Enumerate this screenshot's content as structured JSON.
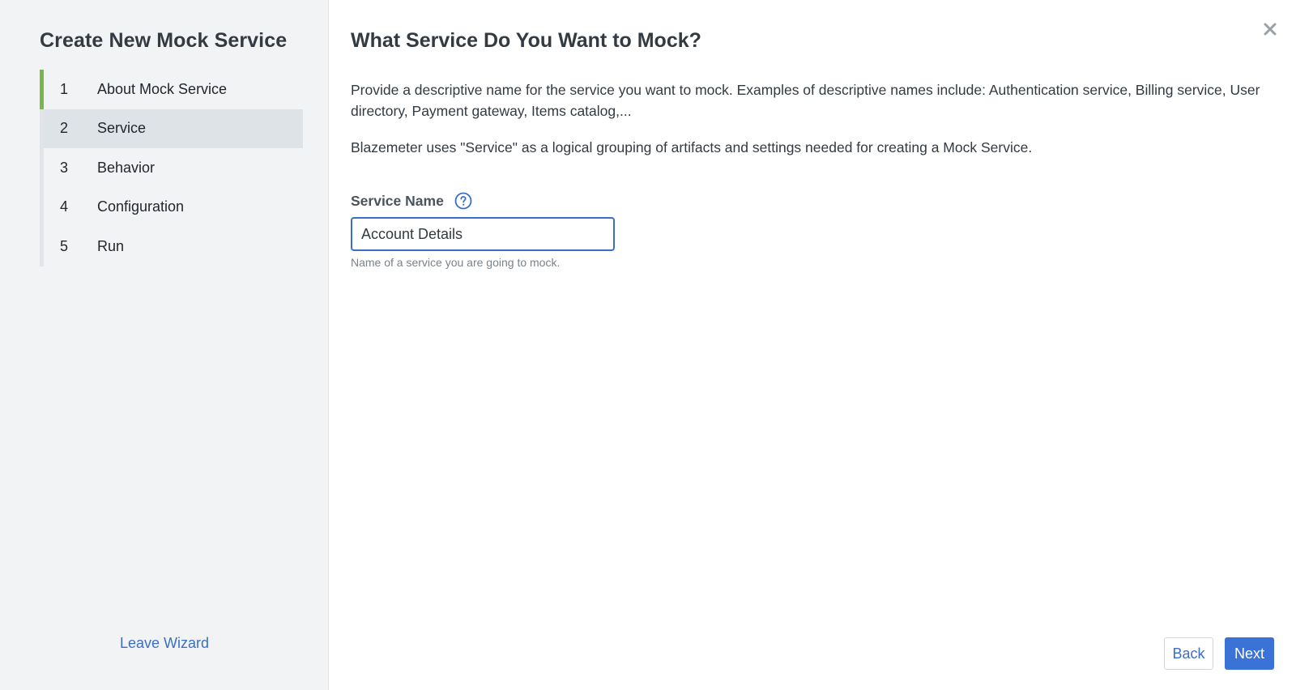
{
  "sidebar": {
    "title": "Create New Mock Service",
    "steps": [
      {
        "number": "1",
        "label": "About Mock Service",
        "state": "done"
      },
      {
        "number": "2",
        "label": "Service",
        "state": "active"
      },
      {
        "number": "3",
        "label": "Behavior",
        "state": "pending"
      },
      {
        "number": "4",
        "label": "Configuration",
        "state": "pending"
      },
      {
        "number": "5",
        "label": "Run",
        "state": "pending"
      }
    ],
    "leave_wizard_label": "Leave Wizard"
  },
  "main": {
    "title": "What Service Do You Want to Mock?",
    "description_1": "Provide a descriptive name for the service you want to mock. Examples of descriptive names include: Authentication service, Billing service, User directory, Payment gateway, Items catalog,...",
    "description_2": "Blazemeter uses \"Service\" as a logical grouping of artifacts and settings needed for creating a Mock Service.",
    "field": {
      "label": "Service Name",
      "value": "Account Details",
      "hint": "Name of a service you are going to mock."
    },
    "buttons": {
      "back_label": "Back",
      "next_label": "Next"
    }
  },
  "icons": {
    "close": "close-icon",
    "help": "help-icon"
  },
  "colors": {
    "accent": "#3a6fc6",
    "primary_button": "#3a72d8",
    "completed_step": "#7ab648",
    "active_step_bg": "#dde3e7",
    "sidebar_bg": "#f2f3f5"
  }
}
